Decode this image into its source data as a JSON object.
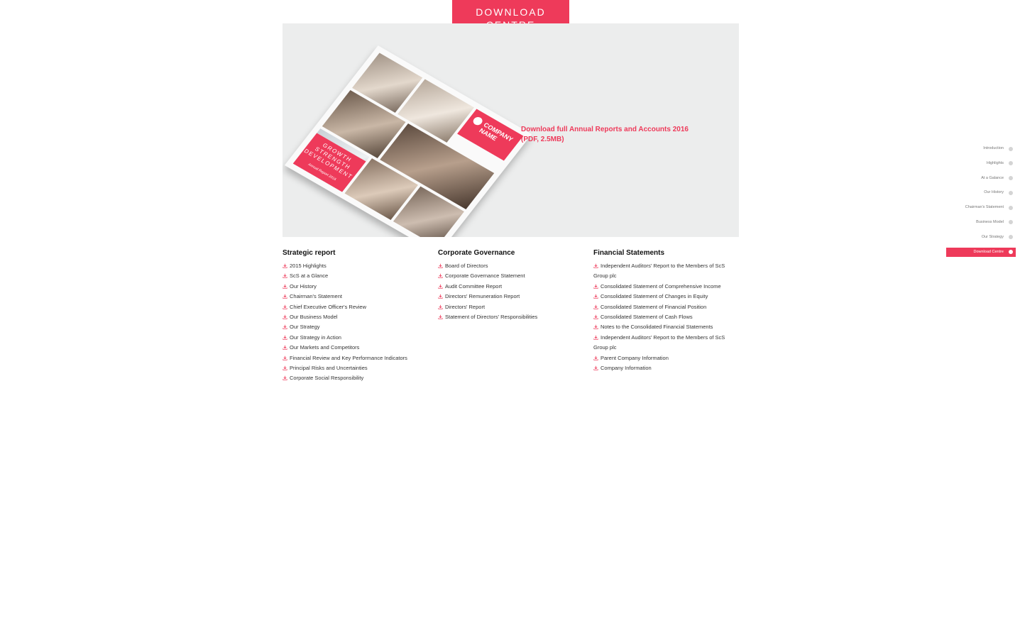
{
  "header": {
    "tab_line1": "DOWNLOAD",
    "tab_line2": "CENTRE"
  },
  "hero": {
    "cover": {
      "company_line1": "COMPANY",
      "company_line2": "NAME",
      "tag_line1": "GROWTH",
      "tag_line2": "STRENGTH",
      "tag_line3": "DEVELOPMENT",
      "tag_sub": "Annual Report 2016"
    },
    "download_link": "Download full Annual Reports and Accounts 2016 (PDF, 2.5MB)"
  },
  "sections": [
    {
      "title": "Strategic report",
      "items": [
        "2015 Highlights",
        "ScS at a Glance",
        "Our History",
        "Chairman's Statement",
        "Chief Executive Officer's Review",
        "Our Business Model",
        "Our Strategy",
        "Our Strategy in Action",
        "Our Markets and Competitors",
        "Financial Review and Key Performance Indicators",
        "Principal Risks and Uncertainties",
        "Corporate Social Responsibility"
      ]
    },
    {
      "title": "Corporate Governance",
      "items": [
        "Board of Directors",
        "Corporate Governance Statement",
        "Audit Committee Report",
        "Directors' Remuneration Report",
        "Directors' Report",
        "Statement of Directors' Responsibilities"
      ]
    },
    {
      "title": "Financial Statements",
      "items": [
        "Independent Auditors' Report to the Members of ScS Group plc",
        "Consolidated Statement of Comprehensive Income",
        "Consolidated Statement of Changes in Equity",
        "Consolidated Statement of Financial Position",
        "Consolidated Statement of Cash Flows",
        "Notes to the Consolidated Financial Statements",
        "Independent Auditors' Report to the Members of ScS Group plc",
        "Parent Company Information",
        "Company Information"
      ]
    }
  ],
  "sidenav": {
    "items": [
      "Introduction",
      "Highlights",
      "At a Galance",
      "Our History",
      "Chairman's Statement",
      "Business Model",
      "Our Strategy",
      "Download Centre"
    ],
    "active": "Download Centre"
  },
  "icons": {
    "download": "download-icon",
    "nav_dot": "dot-icon"
  },
  "colors": {
    "accent": "#ee3a5a",
    "hero_bg": "#eceded"
  }
}
